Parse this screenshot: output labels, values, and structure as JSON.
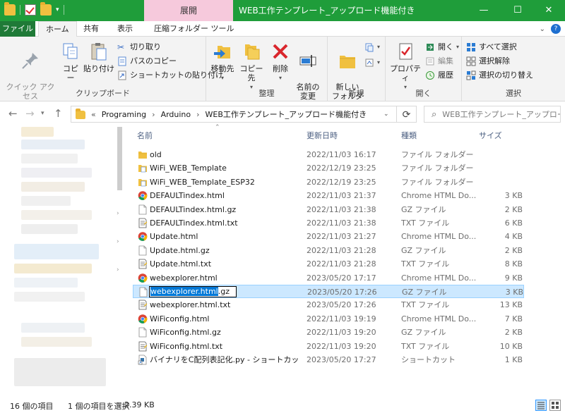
{
  "window": {
    "title": "WEB工作テンプレート_アップロード機能付き",
    "contextual_tab": "展開",
    "minimize": "—",
    "maximize": "☐",
    "close": "✕"
  },
  "tabs": {
    "file": "ファイル",
    "home": "ホーム",
    "share": "共有",
    "view": "表示",
    "compressed_tools": "圧縮フォルダー ツール"
  },
  "ribbon": {
    "clipboard": {
      "label": "クリップボード",
      "pin": "クイック アクセス\nにピン留めする",
      "copy": "コピー",
      "paste": "貼り付け",
      "cut": "切り取り",
      "copy_path": "パスのコピー",
      "paste_shortcut": "ショートカットの貼り付け"
    },
    "organize": {
      "label": "整理",
      "move_to": "移動先",
      "copy_to": "コピー先",
      "delete": "削除",
      "rename": "名前の\n変更"
    },
    "new": {
      "label": "新規",
      "new_folder": "新しい\nフォルダー"
    },
    "open": {
      "label": "開く",
      "properties": "プロパティ",
      "open": "開く",
      "edit": "編集",
      "history": "履歴"
    },
    "select": {
      "label": "選択",
      "select_all": "すべて選択",
      "select_none": "選択解除",
      "invert": "選択の切り替え"
    }
  },
  "address": {
    "path": [
      "Programing",
      "Arduino",
      "WEB工作テンプレート_アップロード機能付き"
    ],
    "chevron": "«",
    "search_placeholder": "WEB工作テンプレート_アップロー..."
  },
  "columns": {
    "name": "名前",
    "date": "更新日時",
    "type": "種類",
    "size": "サイズ"
  },
  "files": [
    {
      "name": "old",
      "date": "2022/11/03 16:17",
      "type": "ファイル フォルダー",
      "size": "",
      "icon": "folder"
    },
    {
      "name": "WiFi_WEB_Template",
      "date": "2022/12/19 23:25",
      "type": "ファイル フォルダー",
      "size": "",
      "icon": "folder-doc"
    },
    {
      "name": "WiFi_WEB_Template_ESP32",
      "date": "2022/12/19 23:25",
      "type": "ファイル フォルダー",
      "size": "",
      "icon": "folder-doc"
    },
    {
      "name": "DEFAULTindex.html",
      "date": "2022/11/03 21:37",
      "type": "Chrome HTML Do...",
      "size": "3 KB",
      "icon": "chrome"
    },
    {
      "name": "DEFAULTindex.html.gz",
      "date": "2022/11/03 21:38",
      "type": "GZ ファイル",
      "size": "2 KB",
      "icon": "blank"
    },
    {
      "name": "DEFAULTindex.html.txt",
      "date": "2022/11/03 21:38",
      "type": "TXT ファイル",
      "size": "6 KB",
      "icon": "txt"
    },
    {
      "name": "Update.html",
      "date": "2022/11/03 21:27",
      "type": "Chrome HTML Do...",
      "size": "4 KB",
      "icon": "chrome"
    },
    {
      "name": "Update.html.gz",
      "date": "2022/11/03 21:28",
      "type": "GZ ファイル",
      "size": "2 KB",
      "icon": "blank"
    },
    {
      "name": "Update.html.txt",
      "date": "2022/11/03 21:28",
      "type": "TXT ファイル",
      "size": "8 KB",
      "icon": "txt"
    },
    {
      "name": "webexplorer.html",
      "date": "2023/05/20 17:17",
      "type": "Chrome HTML Do...",
      "size": "9 KB",
      "icon": "chrome"
    },
    {
      "name": "webexplorer.html.gz",
      "date": "2023/05/20 17:26",
      "type": "GZ ファイル",
      "size": "3 KB",
      "icon": "blank",
      "rename_selected": "webexplorer.html",
      "rename_rest": ".gz"
    },
    {
      "name": "webexplorer.html.txt",
      "date": "2023/05/20 17:26",
      "type": "TXT ファイル",
      "size": "13 KB",
      "icon": "txt"
    },
    {
      "name": "WiFiconfig.html",
      "date": "2022/11/03 19:19",
      "type": "Chrome HTML Do...",
      "size": "7 KB",
      "icon": "chrome"
    },
    {
      "name": "WiFiconfig.html.gz",
      "date": "2022/11/03 19:20",
      "type": "GZ ファイル",
      "size": "2 KB",
      "icon": "blank"
    },
    {
      "name": "WiFiconfig.html.txt",
      "date": "2022/11/03 19:20",
      "type": "TXT ファイル",
      "size": "10 KB",
      "icon": "txt"
    },
    {
      "name": "バイナリをC配列表記化.py - ショートカット",
      "date": "2023/05/20 17:27",
      "type": "ショートカット",
      "size": "1 KB",
      "icon": "shortcut"
    }
  ],
  "status": {
    "count": "16 個の項目",
    "selected": "1 個の項目を選択",
    "size": "2.39 KB"
  },
  "colors": {
    "titlebar": "#1f9d3a",
    "contextual": "#f6c9dc",
    "selection": "#cce8ff",
    "header_text": "#4d6082"
  }
}
